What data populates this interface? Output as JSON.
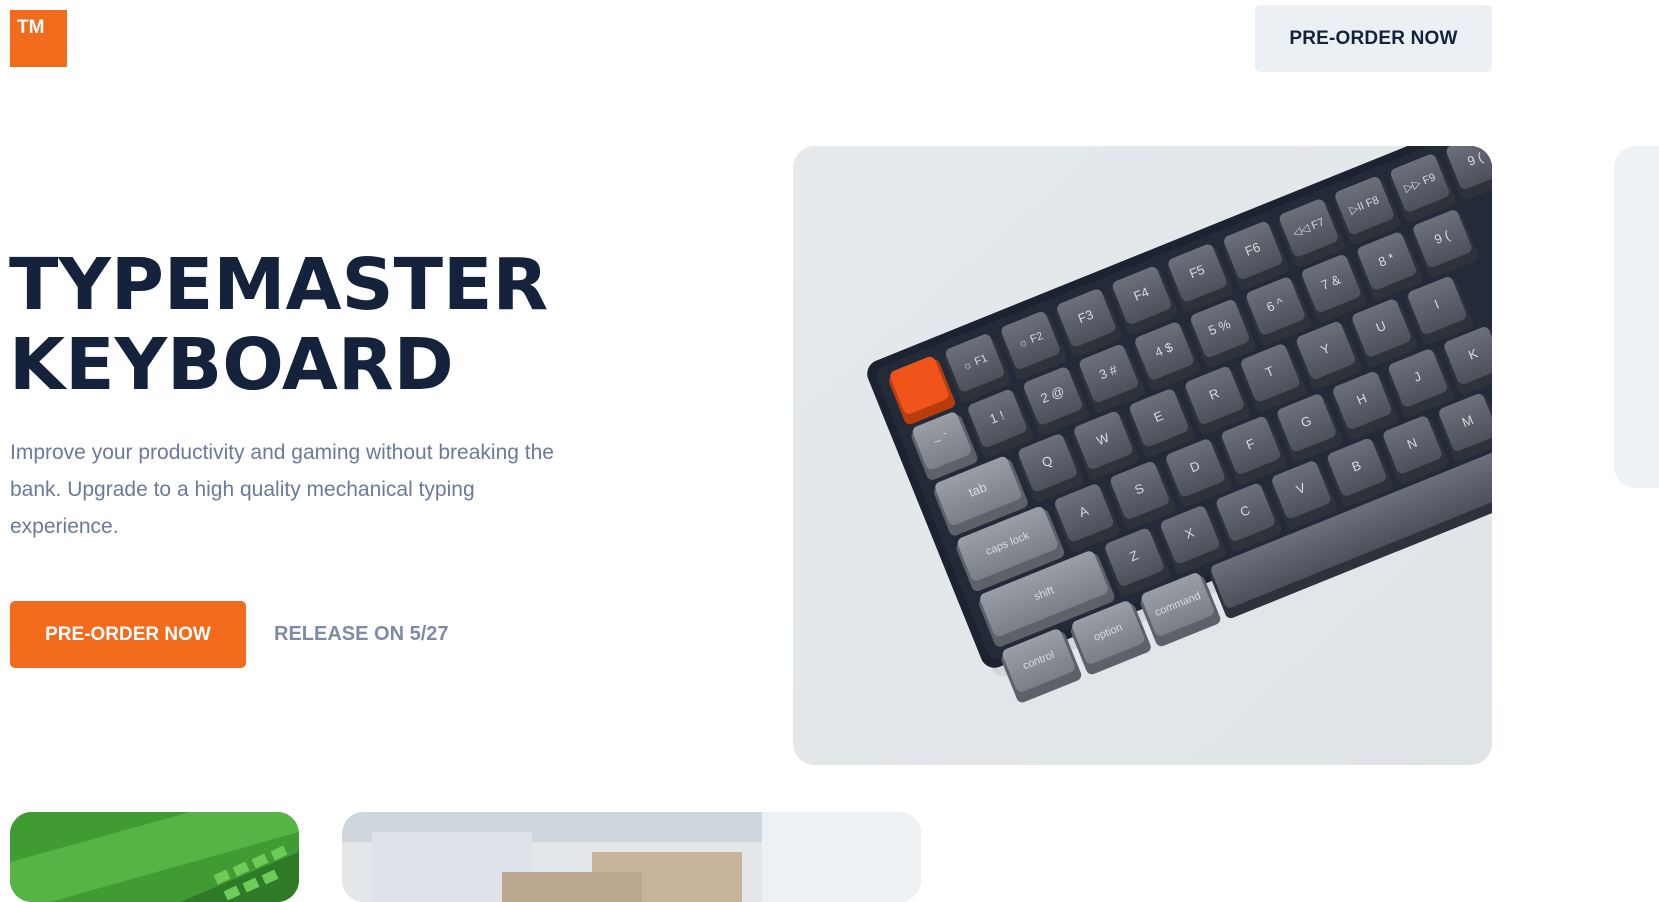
{
  "header": {
    "logo_text": "TM",
    "cta_label": "PRE-ORDER NOW"
  },
  "hero": {
    "title_line1": "TYPEMASTER",
    "title_line2": "KEYBOARD",
    "description": "Improve your productivity and gaming without breaking the bank. Upgrade to a high quality mechanical typing experience.",
    "cta_label": "PRE-ORDER NOW",
    "release_text": "RELEASE ON 5/27"
  },
  "colors": {
    "accent": "#f26a1b",
    "heading": "#15223b",
    "muted_text": "#6a7a9b",
    "nav_button_bg": "#ebf0f4"
  },
  "keyboard_image": {
    "row_function": [
      "☼ F1",
      "☼ F2",
      "F3",
      "F4",
      "F5",
      "F6",
      "◁◁ F7",
      "▷II F8",
      "▷▷ F9",
      "9 ("
    ],
    "row_number": [
      "1 !",
      "2 @",
      "3 #",
      "4 $",
      "5 %",
      "6 ^",
      "7 &",
      "8 *",
      "9 ("
    ],
    "row_q": [
      "tab",
      "Q",
      "W",
      "E",
      "R",
      "T",
      "Y",
      "U",
      "I"
    ],
    "row_a": [
      "caps lock",
      "A",
      "S",
      "D",
      "F",
      "G",
      "H",
      "J",
      "K"
    ],
    "row_z": [
      "shift",
      "Z",
      "X",
      "C",
      "V",
      "B",
      "N",
      "M"
    ],
    "row_bottom": [
      "control",
      "option",
      "command"
    ]
  }
}
